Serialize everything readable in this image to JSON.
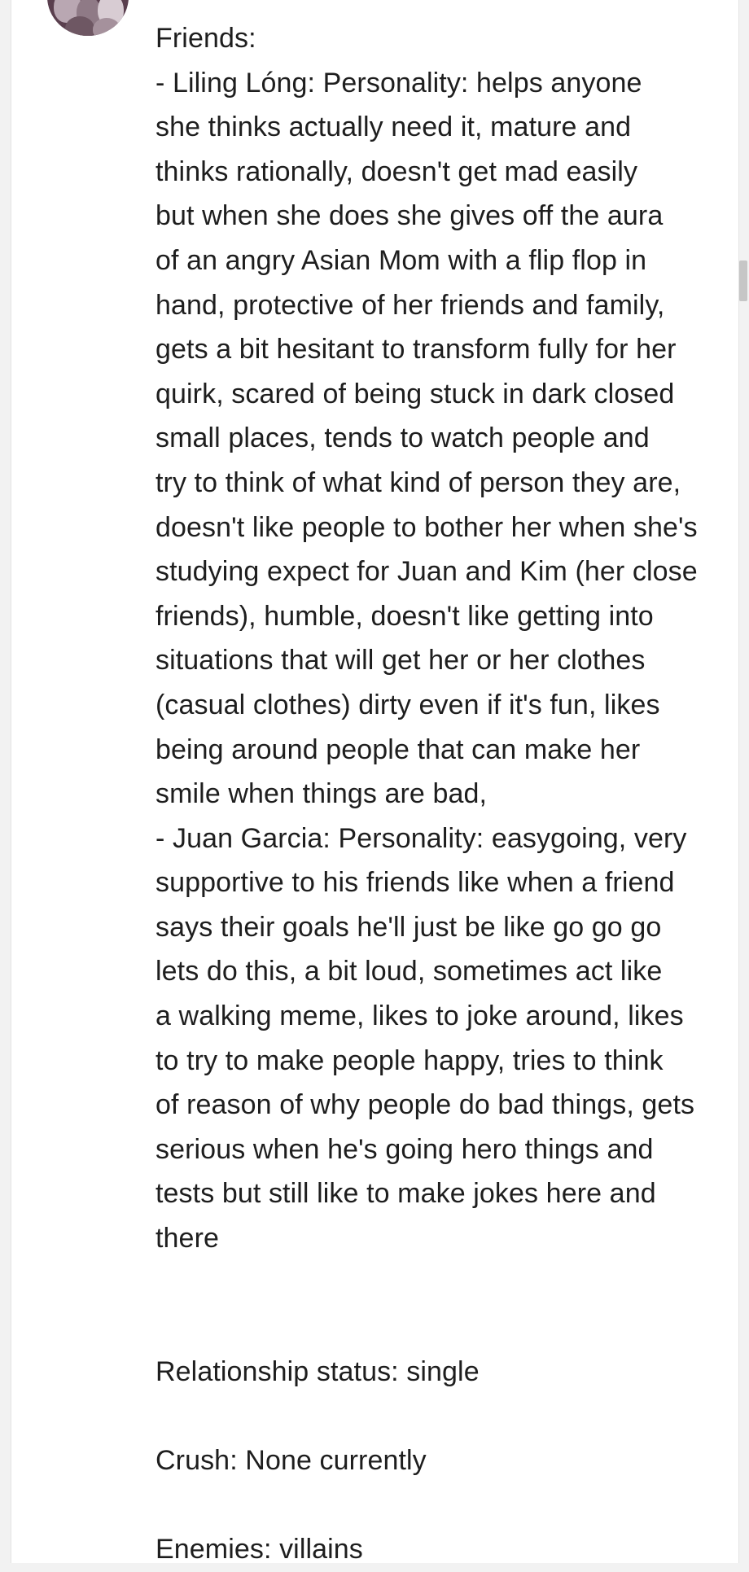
{
  "post": {
    "friends_heading": "Friends:",
    "friend_1_lines": [
      "- Liling Lóng: Personality: helps anyone",
      "she thinks actually need it, mature and",
      "thinks rationally, doesn't get mad easily",
      "but when she does she gives off the aura",
      "of an angry Asian Mom with a flip flop in",
      "hand, protective of her friends and family,",
      "gets a bit hesitant to transform fully for her",
      "quirk, scared of being stuck in dark closed",
      "small places, tends to watch people and",
      "try to think of what kind of person they are,",
      "doesn't like people to bother her when she's",
      "studying expect for Juan and Kim (her close",
      "friends), humble, doesn't like getting into",
      "situations that will get her or her clothes",
      "(casual clothes) dirty even if it's fun, likes",
      "being around people that can make her",
      "smile when things are bad,"
    ],
    "friend_2_lines": [
      "- Juan Garcia: Personality: easygoing, very",
      "supportive to his friends like when a friend",
      "says their goals he'll just be like go go go",
      "lets do this, a bit loud, sometimes act like",
      "a walking meme, likes to joke around, likes",
      "to try to make people happy, tries to think",
      "of reason of why people do bad things, gets",
      "serious when he's going hero things and",
      "tests but still like to make jokes here and",
      "there"
    ],
    "relationship_status": "Relationship status: single",
    "crush": "Crush: None currently",
    "enemies": "Enemies: villains"
  }
}
